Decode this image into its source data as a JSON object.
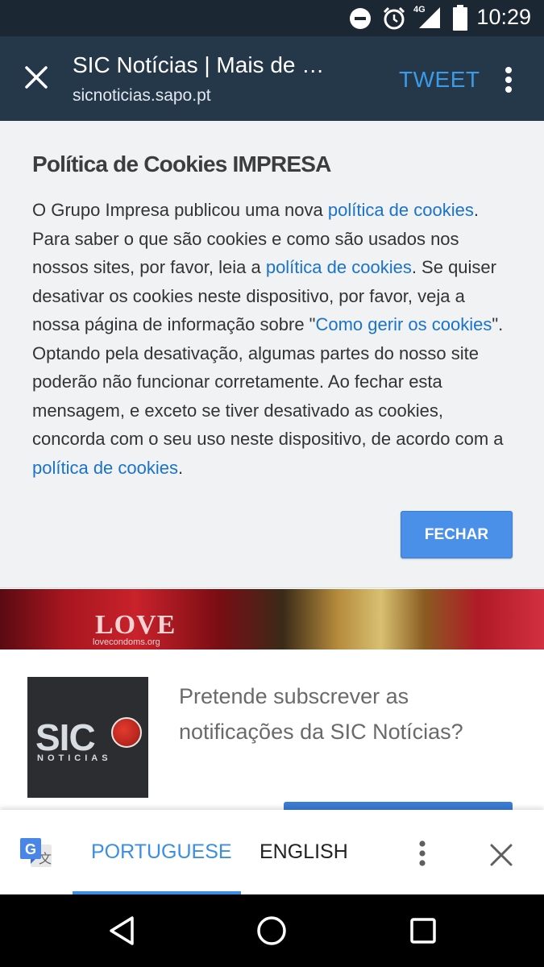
{
  "status_bar": {
    "time": "10:29",
    "network": "4G",
    "icons": [
      "do-not-disturb-icon",
      "alarm-icon",
      "signal-icon",
      "battery-icon"
    ]
  },
  "toolbar": {
    "title": "SIC Notícias | Mais de …",
    "url": "sicnoticias.sapo.pt",
    "tweet_label": "TWEET",
    "close_icon": "close-icon",
    "menu_icon": "more-vert-icon",
    "accent_color": "#3c9ae6"
  },
  "cookie_banner": {
    "heading": "Política de Cookies IMPRESA",
    "p1": "O Grupo Impresa publicou uma nova ",
    "link1": "política de cookies",
    "p2": ". Para saber o que são cookies e como são usados nos nossos sites, por favor, leia a ",
    "link2": "política de cookies",
    "p3": ". Se quiser desativar os cookies neste dispositivo, por favor, veja a nossa página de informação sobre \"",
    "link3": "Como gerir os cookies",
    "p4": "\". Optando pela desativação, algumas partes do nosso site poderão não funcionar corretamente. Ao fechar esta mensagem, e exceto se  tiver desativado as cookies, concorda com o seu uso neste dispositivo, de acordo com a  ",
    "link4": "política de cookies",
    "p5": ".",
    "button_label": "FECHAR",
    "link_color": "#1a73c9",
    "button_color": "#4a90e8"
  },
  "banner_image": {
    "love_text": "LOVE",
    "love_url": "lovecondoms.org"
  },
  "subscribe_prompt": {
    "logo_text": "SIC",
    "logo_subtext": "NOTICIAS",
    "question": "Pretende subscrever as notificações da SIC Notícias?"
  },
  "translate_bar": {
    "source_language": "PORTUGUESE",
    "target_language": "ENGLISH",
    "active_tab": "PORTUGUESE",
    "icons": [
      "google-translate-icon",
      "more-vert-icon",
      "close-icon"
    ],
    "active_color": "#3a8ee6"
  },
  "nav_bar": {
    "buttons": [
      "back-icon",
      "home-icon",
      "recents-icon"
    ]
  }
}
